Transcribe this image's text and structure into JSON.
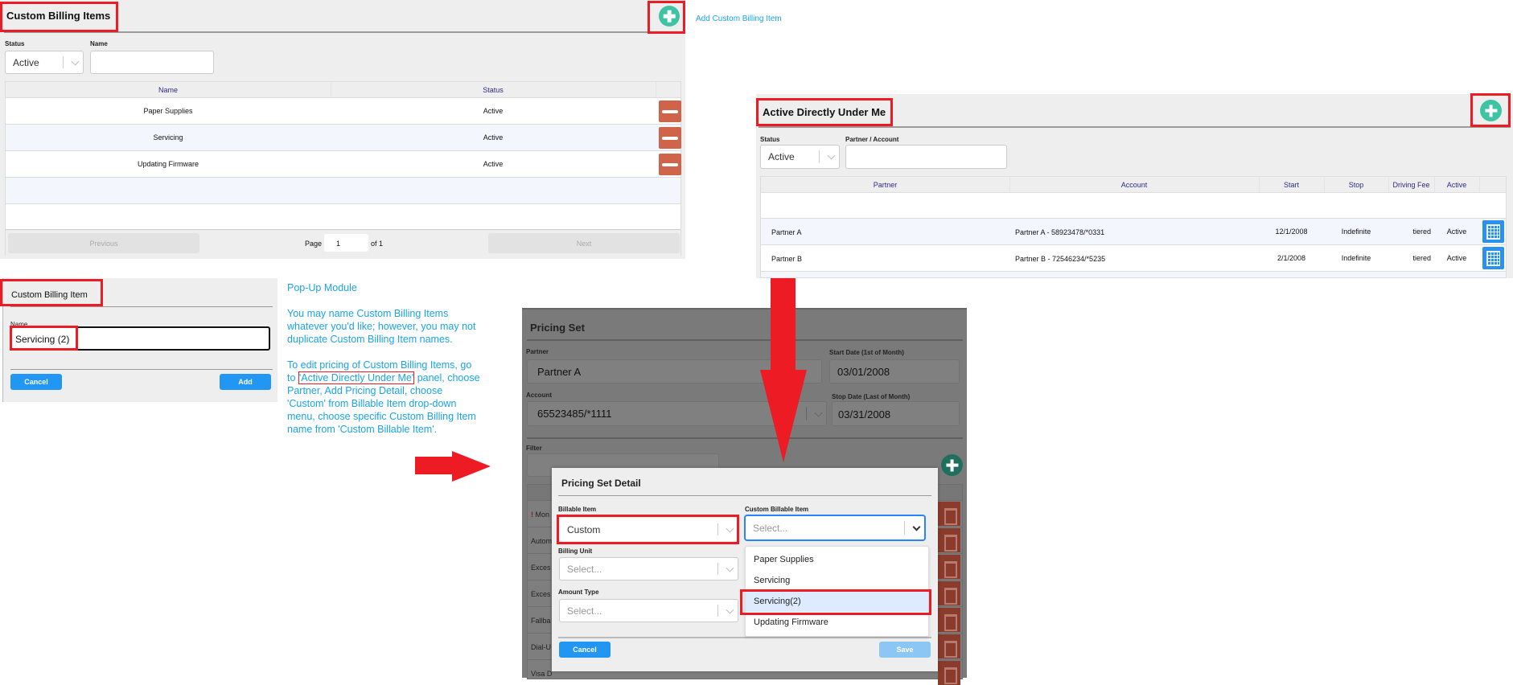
{
  "custom_billing_items": {
    "title": "Custom Billing Items",
    "add_link": "Add Custom Billing Item",
    "filters": {
      "status_label": "Status",
      "status_value": "Active",
      "name_label": "Name",
      "name_value": ""
    },
    "columns": [
      "Name",
      "Status"
    ],
    "rows": [
      {
        "name": "Paper Supplies",
        "status": "Active"
      },
      {
        "name": "Servicing",
        "status": "Active"
      },
      {
        "name": "Updating Firmware",
        "status": "Active"
      }
    ],
    "pager": {
      "previous": "Previous",
      "page_label": "Page",
      "page_value": "1",
      "of_label": "of 1",
      "next": "Next"
    }
  },
  "active_directly": {
    "title": "Active Directly Under Me",
    "filters": {
      "status_label": "Status",
      "status_value": "Active",
      "partner_label": "Partner / Account",
      "partner_value": ""
    },
    "columns": [
      "Partner",
      "Account",
      "Start",
      "Stop",
      "Driving Fee",
      "Active"
    ],
    "rows": [
      {
        "partner": "Partner A",
        "account": "Partner A - 58923478/*0331",
        "start": "12/1/2008",
        "stop": "Indefinite",
        "fee": "tiered",
        "active": "Active"
      },
      {
        "partner": "Partner B",
        "account": "Partner B - 72546234/*5235",
        "start": "2/1/2008",
        "stop": "Indefinite",
        "fee": "tiered",
        "active": "Active"
      }
    ]
  },
  "popup": {
    "title": "Custom Billing Item",
    "name_label": "Name",
    "name_value": "Servicing (2)",
    "cancel": "Cancel",
    "add": "Add"
  },
  "notes": {
    "heading": "Pop-Up Module",
    "p1": [
      "You may name Custom Billing Items",
      "whatever you'd like; however, you may not",
      "duplicate Custom Billing Item names."
    ],
    "p2_line1": "To edit pricing of Custom Billing Items, go",
    "p2_line2_pre": "to ",
    "p2_line2_box": "'Active Directly Under Me'",
    "p2_line2_post": " panel, choose",
    "p2_rest": [
      "Partner, Add Pricing Detail, choose",
      "'Custom' from Billable Item drop-down",
      "menu, choose specific Custom Billing Item",
      "name from 'Custom Billable Item'."
    ]
  },
  "pricing_set": {
    "title": "Pricing Set",
    "partner_label": "Partner",
    "partner_value": "Partner A",
    "start_label": "Start Date (1st of Month)",
    "start_value": "03/01/2008",
    "account_label": "Account",
    "account_value": "65523485/*1111",
    "stop_label": "Stop Date (Last of Month)",
    "stop_value": "03/31/2008",
    "filter_label": "Filter",
    "rows": [
      "Mon",
      "Autom",
      "Exces",
      "Exces",
      "Fallba",
      "Dial-U",
      "Visa D"
    ]
  },
  "pricing_detail": {
    "title": "Pricing Set Detail",
    "billable_label": "Billable Item",
    "billable_value": "Custom",
    "custom_label": "Custom Billable Item",
    "custom_placeholder": "Select...",
    "unit_label": "Billing Unit",
    "unit_placeholder": "Select...",
    "amount_label": "Amount Type",
    "amount_placeholder": "Select...",
    "options": [
      "Paper Supplies",
      "Servicing",
      "Servicing(2)",
      "Updating Firmware"
    ],
    "highlighted_option": "Servicing(2)",
    "cancel": "Cancel",
    "save": "Save"
  },
  "colors": {
    "annotation_red": "#ed1c24",
    "add_teal": "#3ec4a5",
    "remove_red": "#d0644a",
    "button_blue": "#2196f3",
    "note_blue": "#1aa3e8",
    "header_navy": "#2e2a8a"
  }
}
